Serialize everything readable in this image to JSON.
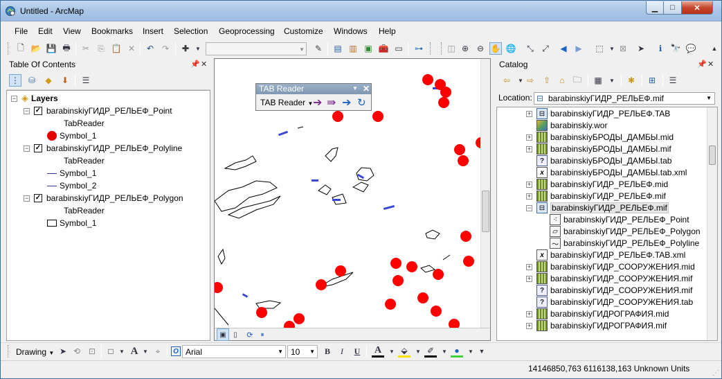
{
  "window": {
    "title": "Untitled - ArcMap",
    "controls": {
      "minimize": "▁",
      "maximize": "□",
      "close": "✕"
    }
  },
  "menu": [
    "File",
    "Edit",
    "View",
    "Bookmarks",
    "Insert",
    "Selection",
    "Geoprocessing",
    "Customize",
    "Windows",
    "Help"
  ],
  "toc": {
    "title": "Table Of Contents",
    "root": "Layers",
    "layers": [
      {
        "name": "barabinskiyГИДР_РЕЛЬЕФ_Point",
        "renderer": "TabReader",
        "symbols": [
          "Symbol_1"
        ],
        "symbol_type": "point",
        "checked": true
      },
      {
        "name": "barabinskiyГИДР_РЕЛЬЕФ_Polyline",
        "renderer": "TabReader",
        "symbols": [
          "Symbol_1",
          "Symbol_2"
        ],
        "symbol_type": "line",
        "checked": true
      },
      {
        "name": "barabinskiyГИДР_РЕЛЬЕФ_Polygon",
        "renderer": "TabReader",
        "symbols": [
          "Symbol_1"
        ],
        "symbol_type": "polygon",
        "checked": true
      }
    ]
  },
  "tab_reader": {
    "title": "TAB Reader",
    "menu_label": "TAB Reader"
  },
  "catalog": {
    "title": "Catalog",
    "location_label": "Location:",
    "location_value": "barabinskiyГИДР_РЕЛЬЕФ.mif",
    "items": [
      {
        "name": "barabinskiyГИДР_РЕЛЬЕФ.TAB",
        "icon": "tab-table-icon",
        "expandable": true,
        "level": 0
      },
      {
        "name": "barabinskiy.wor",
        "icon": "workspace-icon",
        "expandable": false,
        "level": 0
      },
      {
        "name": "barabinskiyБРОДЫ_ДАМБЫ.mid",
        "icon": "raster-icon",
        "expandable": true,
        "level": 0
      },
      {
        "name": "barabinskiyБРОДЫ_ДАМБЫ.mif",
        "icon": "raster-icon",
        "expandable": true,
        "level": 0
      },
      {
        "name": "barabinskiyБРОДЫ_ДАМБЫ.tab",
        "icon": "unknown-file-icon",
        "expandable": false,
        "level": 0
      },
      {
        "name": "barabinskiyБРОДЫ_ДАМБЫ.tab.xml",
        "icon": "xml-file-icon",
        "expandable": false,
        "level": 0
      },
      {
        "name": "barabinskiyГИДР_РЕЛЬЕФ.mid",
        "icon": "raster-icon",
        "expandable": true,
        "level": 0
      },
      {
        "name": "barabinskiyГИДР_РЕЛЬЕФ.mif",
        "icon": "raster-icon",
        "expandable": true,
        "level": 0
      },
      {
        "name": "barabinskiyГИДР_РЕЛЬЕФ.mif",
        "icon": "tab-table-icon",
        "expandable": true,
        "expanded": true,
        "selected": true,
        "level": 0
      },
      {
        "name": "barabinskiyГИДР_РЕЛЬЕФ_Point",
        "icon": "point-featureclass-icon",
        "expandable": false,
        "level": 1
      },
      {
        "name": "barabinskiyГИДР_РЕЛЬЕФ_Polygon",
        "icon": "polygon-featureclass-icon",
        "expandable": false,
        "level": 1
      },
      {
        "name": "barabinskiyГИДР_РЕЛЬЕФ_Polyline",
        "icon": "polyline-featureclass-icon",
        "expandable": false,
        "level": 1
      },
      {
        "name": "barabinskiyГИДР_РЕЛЬЕФ.TAB.xml",
        "icon": "xml-file-icon",
        "expandable": false,
        "level": 0
      },
      {
        "name": "barabinskiyГИДР_СООРУЖЕНИЯ.mid",
        "icon": "raster-icon",
        "expandable": true,
        "level": 0
      },
      {
        "name": "barabinskiyГИДР_СООРУЖЕНИЯ.mif",
        "icon": "raster-icon",
        "expandable": true,
        "level": 0
      },
      {
        "name": "barabinskiyГИДР_СООРУЖЕНИЯ.mif",
        "icon": "unknown-file-icon",
        "expandable": false,
        "level": 0
      },
      {
        "name": "barabinskiyГИДР_СООРУЖЕНИЯ.tab",
        "icon": "unknown-file-icon",
        "expandable": false,
        "level": 0
      },
      {
        "name": "barabinskiyГИДРОГРАФИЯ.mid",
        "icon": "raster-icon",
        "expandable": true,
        "level": 0
      },
      {
        "name": "barabinskiyГИДРОГРАФИЯ.mif",
        "icon": "raster-icon",
        "expandable": true,
        "level": 0
      }
    ]
  },
  "drawing": {
    "drawing_label": "Drawing",
    "font_name": "Arial",
    "font_size": "10",
    "bold": "B",
    "italic": "I",
    "underline": "U",
    "text_color_glyph": "A"
  },
  "status": {
    "coordinates": "14146850,763  6116138,163 Unknown Units"
  },
  "colors": {
    "point_symbol": "#ff0000",
    "line_symbol": "#3a46d8",
    "accent": "#3c6e9e"
  }
}
